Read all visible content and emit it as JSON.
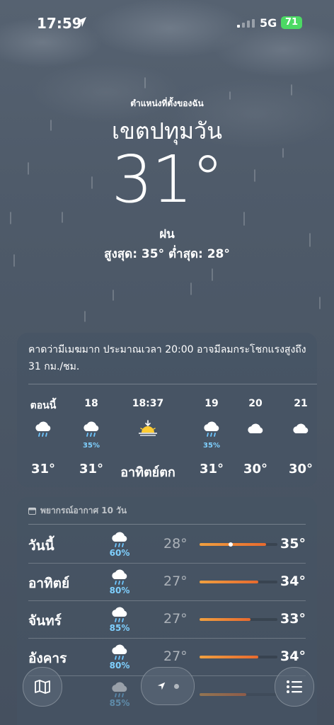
{
  "status_bar": {
    "time": "17:59",
    "network": "5G",
    "battery": "71",
    "icons": [
      "location-arrow-icon",
      "signal-bars-icon",
      "battery-icon"
    ]
  },
  "header": {
    "my_location_label": "ตำแหน่งที่ตั้งของฉัน",
    "city": "เขตปทุมวัน",
    "temperature": "31°",
    "condition": "ฝน",
    "high_low": "สูงสุด: 35°  ต่ำสุด: 28°"
  },
  "hourly": {
    "summary": "คาดว่ามีเมฆมาก ประมาณเวลา 20:00 อาจมีลมกระโชกแรงสูงถึง 31 กม./ชม.",
    "items": [
      {
        "label": "ตอนนี้",
        "icon": "cloud-rain-icon",
        "pop": "",
        "temp": "31°"
      },
      {
        "label": "18",
        "icon": "cloud-rain-icon",
        "pop": "35%",
        "temp": "31°"
      },
      {
        "label": "18:37",
        "icon": "sunset-icon",
        "pop": "",
        "temp": "อาทิตย์ตก"
      },
      {
        "label": "19",
        "icon": "cloud-rain-icon",
        "pop": "35%",
        "temp": "31°"
      },
      {
        "label": "20",
        "icon": "cloud-icon",
        "pop": "",
        "temp": "30°"
      },
      {
        "label": "21",
        "icon": "cloud-icon",
        "pop": "",
        "temp": "30°"
      }
    ]
  },
  "daily": {
    "title": "พยากรณ์อากาศ 10 วัน",
    "days": [
      {
        "name": "วันนี้",
        "icon": "cloud-rain-icon",
        "pop": "60%",
        "low": "28°",
        "high": "35°",
        "bar_start": 0.0,
        "bar_end": 0.85,
        "current": 0.4
      },
      {
        "name": "อาทิตย์",
        "icon": "cloud-rain-icon",
        "pop": "80%",
        "low": "27°",
        "high": "34°",
        "bar_start": 0.0,
        "bar_end": 0.75,
        "current": null
      },
      {
        "name": "จันทร์",
        "icon": "cloud-rain-icon",
        "pop": "85%",
        "low": "27°",
        "high": "33°",
        "bar_start": 0.0,
        "bar_end": 0.65,
        "current": null
      },
      {
        "name": "อังคาร",
        "icon": "cloud-rain-icon",
        "pop": "80%",
        "low": "27°",
        "high": "34°",
        "bar_start": 0.0,
        "bar_end": 0.75,
        "current": null
      },
      {
        "name": "",
        "icon": "cloud-rain-icon",
        "pop": "85%",
        "low": "",
        "high": "",
        "bar_start": 0.0,
        "bar_end": 0.6,
        "current": null
      }
    ]
  },
  "toolbar": {
    "map_icon": "map-icon",
    "list_icon": "list-icon",
    "page_indicator": [
      "location-arrow-icon",
      "page-dot"
    ]
  }
}
